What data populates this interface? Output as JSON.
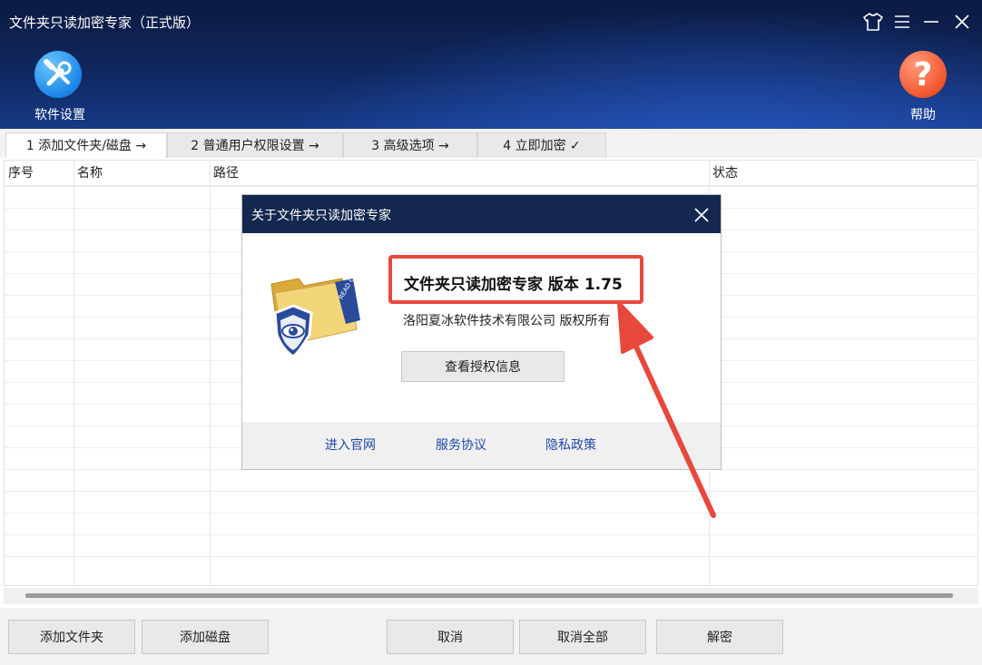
{
  "window": {
    "title": "文件夹只读加密专家（正式版）",
    "controls": [
      "skin-icon",
      "menu-icon",
      "minimize-icon",
      "close-icon"
    ]
  },
  "toolbar": {
    "settings_label": "软件设置",
    "help_label": "帮助"
  },
  "steps": [
    {
      "label": "1 添加文件夹/磁盘 →"
    },
    {
      "label": "2 普通用户权限设置 →"
    },
    {
      "label": "3 高级选项 →"
    },
    {
      "label": "4 立即加密 ✓"
    }
  ],
  "table": {
    "columns": [
      "序号",
      "名称",
      "路径",
      "状态"
    ],
    "rows": []
  },
  "buttons": {
    "add_folder": "添加文件夹",
    "add_disk": "添加磁盘",
    "cancel": "取消",
    "cancel_all": "取消全部",
    "decrypt": "解密"
  },
  "dialog": {
    "title": "关于文件夹只读加密专家",
    "product_title": "文件夹只读加密专家 版本 1.75",
    "copyright": "洛阳夏冰软件技术有限公司 版权所有",
    "view_license": "查看授权信息",
    "links": [
      "进入官网",
      "服务协议",
      "隐私政策"
    ],
    "icon_text": "READ ONLY"
  },
  "colors": {
    "header_dark": "#0b1a40",
    "dialog_titlebar": "#14284f",
    "annotation_red": "#e8483c",
    "link_blue": "#1f4aa8"
  }
}
